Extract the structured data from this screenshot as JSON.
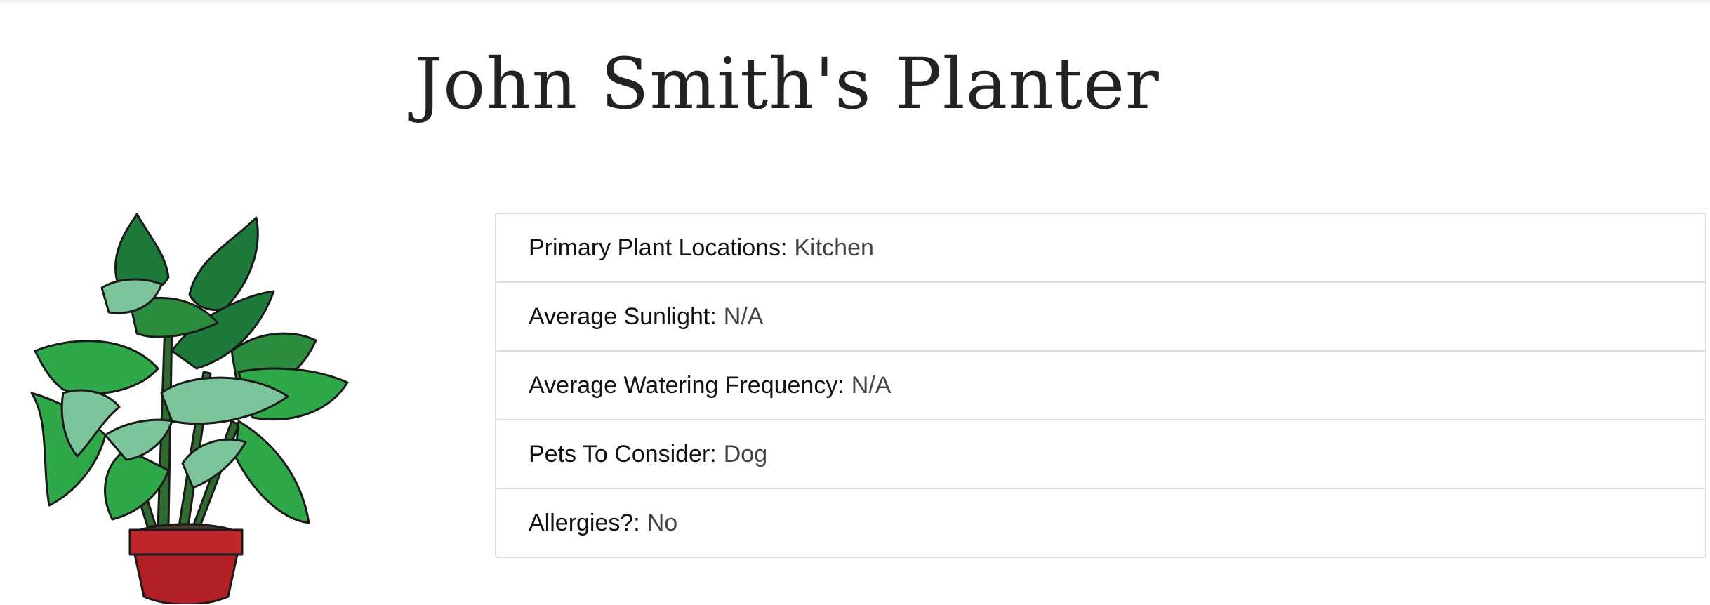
{
  "page": {
    "title": "John Smith's Planter"
  },
  "image": {
    "icon": "potted-plant",
    "colors": {
      "leaf_dark": "#1e7a3a",
      "leaf_mid": "#2fa84a",
      "leaf_light": "#7cc49a",
      "pot": "#c0272d",
      "outline": "#1a1a1a"
    }
  },
  "details": [
    {
      "label": "Primary Plant Locations:",
      "value": "Kitchen"
    },
    {
      "label": "Average Sunlight:",
      "value": "N/A"
    },
    {
      "label": "Average Watering Frequency:",
      "value": "N/A"
    },
    {
      "label": "Pets To Consider:",
      "value": "Dog"
    },
    {
      "label": "Allergies?:",
      "value": "No"
    }
  ]
}
